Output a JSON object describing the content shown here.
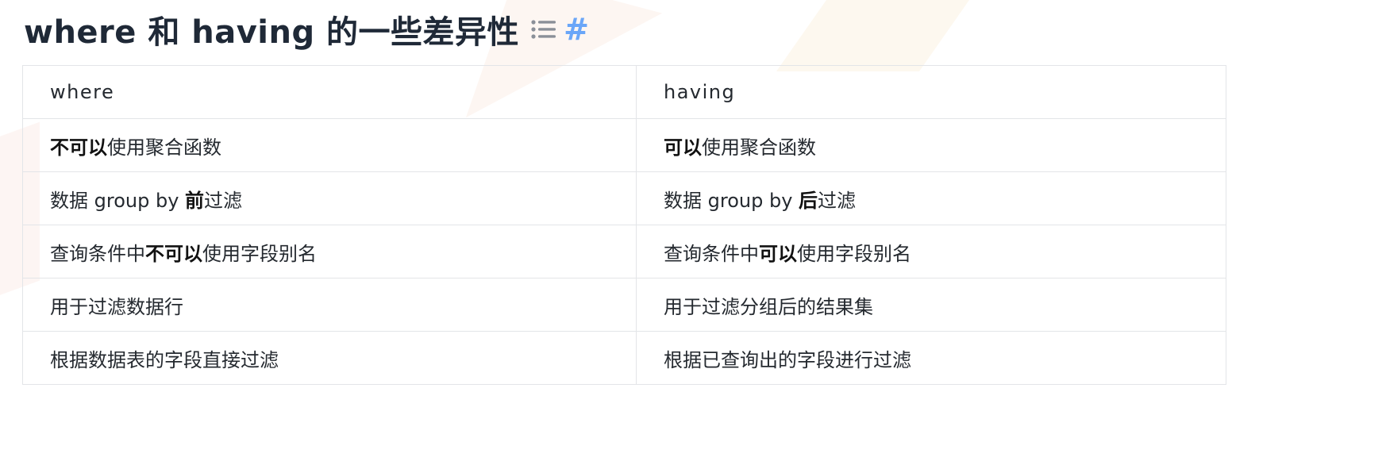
{
  "heading": {
    "title": "where 和 having 的一些差异性",
    "toc_icon": "list-icon",
    "anchor_label": "#",
    "anchor_color": "#6aa6f8"
  },
  "table": {
    "headers": [
      "where",
      "having"
    ],
    "rows": [
      [
        {
          "pre": "",
          "bold": "不可以",
          "post": "使用聚合函数"
        },
        {
          "pre": "",
          "bold": "可以",
          "post": "使用聚合函数"
        }
      ],
      [
        {
          "pre": "数据 group by ",
          "bold": "前",
          "post": "过滤"
        },
        {
          "pre": "数据 group by ",
          "bold": "后",
          "post": "过滤"
        }
      ],
      [
        {
          "pre": "查询条件中",
          "bold": "不可以",
          "post": "使用字段别名"
        },
        {
          "pre": "查询条件中",
          "bold": "可以",
          "post": "使用字段别名"
        }
      ],
      [
        {
          "pre": "用于过滤数据行",
          "bold": "",
          "post": ""
        },
        {
          "pre": "用于过滤分组后的结果集",
          "bold": "",
          "post": ""
        }
      ],
      [
        {
          "pre": "根据数据表的字段直接过滤",
          "bold": "",
          "post": ""
        },
        {
          "pre": "根据已查询出的字段进行过滤",
          "bold": "",
          "post": ""
        }
      ]
    ]
  }
}
